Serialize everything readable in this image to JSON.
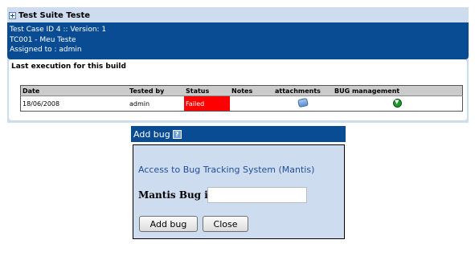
{
  "test_suite": {
    "title": "Test Suite Teste"
  },
  "test_case": {
    "id_line": "Test Case ID 4 :: Version: 1",
    "name_line": "TC001 - Meu Teste",
    "assigned_line": "Assigned to : admin"
  },
  "execution": {
    "title": "Last execution for this build",
    "columns": [
      "Date",
      "Tested by",
      "Status",
      "Notes",
      "attachments",
      "BUG management"
    ],
    "rows": [
      {
        "date": "18/06/2008",
        "tested_by": "admin",
        "status": "Failed",
        "notes": ""
      }
    ],
    "status_color_failed": "#ff0000"
  },
  "add_bug_dialog": {
    "title": "Add bug",
    "help_icon": "?",
    "access_link": "Access to Bug Tracking System (Mantis)",
    "bug_id_label": "Mantis Bug id",
    "bug_id_value": "",
    "add_button": "Add bug",
    "close_button": "Close"
  },
  "colors": {
    "header_blue": "#0a4c93",
    "panel_bg": "#cddcef",
    "link": "#1f4f9c"
  },
  "icons": {
    "toggle": "expand-toggle-icon",
    "attachment": "attachment-icon",
    "bug": "bug-add-icon",
    "help": "help-icon"
  }
}
